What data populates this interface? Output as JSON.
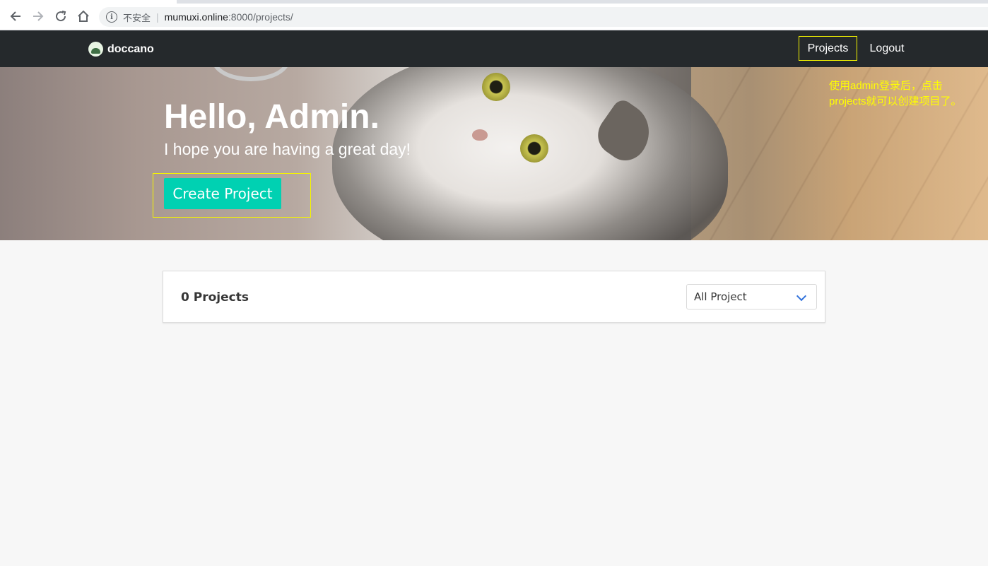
{
  "browser": {
    "security_label": "不安全",
    "url_host": "mumuxi.online",
    "url_path": ":8000/projects/",
    "icons": [
      "back-arrow-icon",
      "forward-arrow-icon",
      "reload-icon",
      "home-icon",
      "info-icon"
    ]
  },
  "navbar": {
    "brand": "doccano",
    "links": [
      "Projects",
      "Logout"
    ],
    "bg_color": "#25292c"
  },
  "hero": {
    "title": "Hello, Admin.",
    "subtitle": "I hope you are having a great day!",
    "create_button": "Create Project",
    "button_color": "#00d1b2"
  },
  "annotation": {
    "line1": "使用admin登录后，点击",
    "line2": "projects就可以创建项目了。",
    "color": "#ffff00"
  },
  "projects_card": {
    "title": "0 Projects",
    "filter_selected": "All Project"
  }
}
